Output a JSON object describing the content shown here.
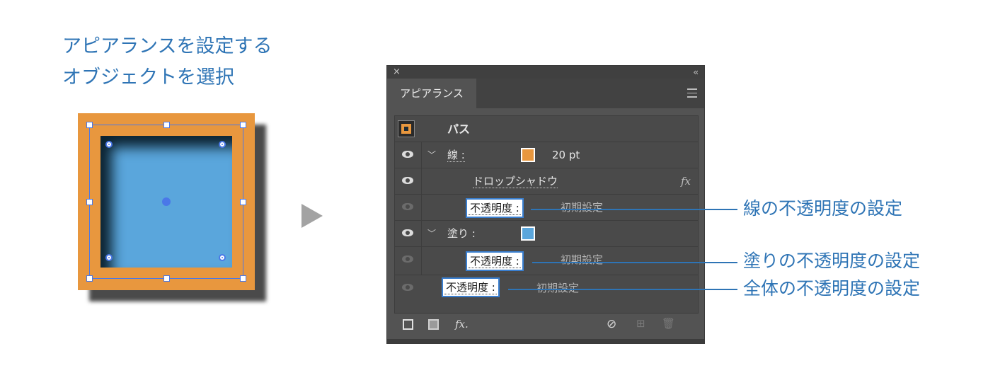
{
  "caption": {
    "line1": "アピアランスを設定する",
    "line2": "オブジェクトを選択"
  },
  "colors": {
    "accent": "#2e74b5",
    "stroke_swatch": "#e8973e",
    "fill_swatch": "#5aa6dc",
    "panel_bg": "#535353"
  },
  "panel": {
    "tab_label": "アピアランス",
    "close_glyph": "×",
    "collapse_glyph": "‹‹",
    "header": {
      "label": "パス"
    },
    "stroke_row": {
      "label": "線 :",
      "weight": "20 pt"
    },
    "effect_row": {
      "label": "ドロップシャドウ",
      "fx_glyph": "fx"
    },
    "stroke_opacity_row": {
      "label": "不透明度 :",
      "value": "初期設定"
    },
    "fill_row": {
      "label": "塗り :"
    },
    "fill_opacity_row": {
      "label": "不透明度 :",
      "value": "初期設定"
    },
    "object_opacity_row": {
      "label": "不透明度 :",
      "value": "初期設定"
    },
    "bottom_fx_glyph": "fx."
  },
  "annotations": {
    "stroke": "線の不透明度の設定",
    "fill": "塗りの不透明度の設定",
    "object": "全体の不透明度の設定"
  }
}
